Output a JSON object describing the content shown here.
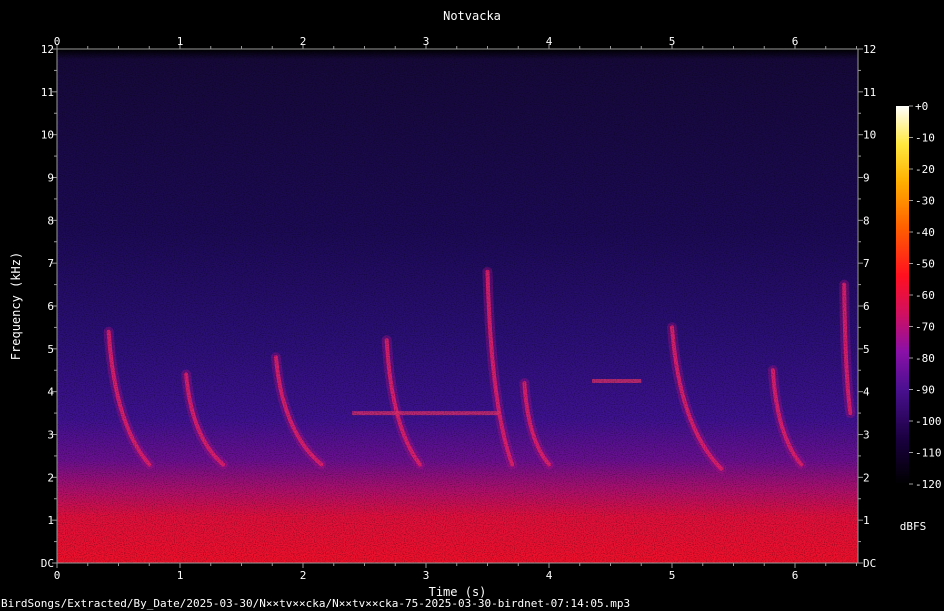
{
  "title": "Notvacka",
  "footer_path": "BirdSongs/Extracted/By_Date/2025-03-30/N××tv××cka/N××tv××cka-75-2025-03-30-birdnet-07:14:05.mp3",
  "chart_data": {
    "type": "heatmap",
    "title": "Notvacka",
    "xlabel": "Time (s)",
    "ylabel": "Frequency (kHz)",
    "xlim": [
      0,
      6.5
    ],
    "ylim": [
      0,
      12
    ],
    "x_ticks": [
      "0",
      "1",
      "2",
      "3",
      "4",
      "5",
      "6"
    ],
    "y_ticks": [
      "DC",
      "1",
      "2",
      "3",
      "4",
      "5",
      "6",
      "7",
      "8",
      "9",
      "10",
      "11",
      "12"
    ],
    "colorbar": {
      "label": "dBFS",
      "range": [
        -120,
        0
      ],
      "ticks": [
        "+0",
        "-10",
        "-20",
        "-30",
        "-40",
        "-50",
        "-60",
        "-70",
        "-80",
        "-90",
        "-100",
        "-110",
        "-120"
      ],
      "colors": [
        "#000000",
        "#1a0040",
        "#4a1090",
        "#8a10a8",
        "#d01060",
        "#ff1020",
        "#ff6000",
        "#ffb000",
        "#ffe840",
        "#ffffff"
      ]
    },
    "noise_floor_khz": 11.6,
    "strong_band_khz": [
      0,
      1.5
    ],
    "calls": [
      {
        "t_start": 0.42,
        "f_start": 5.4,
        "t_end": 0.75,
        "f_end": 2.3
      },
      {
        "t_start": 1.05,
        "f_start": 4.4,
        "t_end": 1.35,
        "f_end": 2.3
      },
      {
        "t_start": 1.78,
        "f_start": 4.8,
        "t_end": 2.15,
        "f_end": 2.3
      },
      {
        "t_start": 2.68,
        "f_start": 5.2,
        "t_end": 2.95,
        "f_end": 2.3
      },
      {
        "t_start": 3.5,
        "f_start": 6.8,
        "t_end": 3.7,
        "f_end": 2.3
      },
      {
        "t_start": 3.8,
        "f_start": 4.2,
        "t_end": 4.0,
        "f_end": 2.3
      },
      {
        "t_start": 5.0,
        "f_start": 5.5,
        "t_end": 5.4,
        "f_end": 2.2
      },
      {
        "t_start": 5.82,
        "f_start": 4.5,
        "t_end": 6.05,
        "f_end": 2.3
      },
      {
        "t_start": 6.4,
        "f_start": 6.5,
        "t_end": 6.45,
        "f_end": 3.5
      }
    ],
    "tones": [
      {
        "t_start": 2.4,
        "t_end": 3.6,
        "f": 3.5
      },
      {
        "t_start": 4.35,
        "t_end": 4.75,
        "f": 4.25
      }
    ]
  }
}
